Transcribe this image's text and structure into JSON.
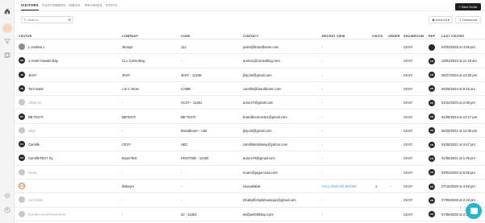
{
  "nav": {
    "tabs": [
      {
        "label": "VISITORS",
        "active": true
      },
      {
        "label": "CUSTOMERS",
        "active": false
      },
      {
        "label": "INBOX",
        "active": false
      },
      {
        "label": "REVIEWS",
        "active": false
      },
      {
        "label": "STATS",
        "active": false
      }
    ],
    "new_order_label": "New Order"
  },
  "toolbar": {
    "search_placeholder": "Search",
    "view_all_label": "View All",
    "download_label": "Download"
  },
  "table": {
    "headers": [
      "VISITOR",
      "COMPANY",
      "CODE",
      "CONTACT",
      "RECENT VIEW",
      "VISITS",
      "ORDER",
      "SHOWROOM",
      "REP",
      "LAST VISITED"
    ],
    "rows": [
      {
        "avatar": "",
        "avatar_style": "photo",
        "visitor": "L Andrew L",
        "company": "Jbongs",
        "code": "111",
        "contact": "justin@brandboom.com",
        "recent_view": "-",
        "visits": "",
        "order": "",
        "showroom": "CKSY",
        "rep": "",
        "last_visited": "04/03/2025 at 4:06 pm",
        "muted": false
      },
      {
        "avatar": "HH",
        "avatar_style": "dark",
        "visitor": "1 Hotel Hanalei Bay",
        "company": "CLJ Consulting",
        "code": "-",
        "contact": "aurie11@consulting.com",
        "recent_view": "-",
        "visits": "",
        "order": "",
        "showroom": "CKSY",
        "rep": "CR",
        "last_visited": "10/01/2024 at 11:19 am",
        "muted": false
      },
      {
        "avatar": "JK",
        "avatar_style": "dark",
        "visitor": "JKSY",
        "company": "JKSY",
        "code": "JKSY - 11248",
        "contact": "jksy.lol@gmail.com",
        "recent_view": "-",
        "visits": "",
        "order": "",
        "showroom": "CKSY",
        "rep": "CR",
        "last_visited": "06/27/2024 at 12:53 pm",
        "muted": false
      },
      {
        "avatar": "TS",
        "avatar_style": "dark",
        "visitor": "Toni Stark",
        "company": "J & C Store",
        "code": "CAMB",
        "contact": "camille@brandboom.com",
        "recent_view": "-",
        "visits": "",
        "order": "",
        "showroom": "CKSY",
        "rep": "CR",
        "last_visited": "06/26/2024 at 9:45 am",
        "muted": false
      },
      {
        "avatar": "",
        "avatar_style": "grey",
        "visitor": "Jillian Sy",
        "company": "-",
        "code": "ACSY - 11251",
        "contact": "aurum7@gmail.com",
        "recent_view": "-",
        "visits": "",
        "order": "",
        "showroom": "CKSY",
        "rep": "CR",
        "last_visited": "01/22/2024 at 2:08 pm",
        "muted": true
      },
      {
        "avatar": "BT",
        "avatar_style": "dark",
        "visitor": "BB TESTI",
        "company": "BBTESTI",
        "code": "BB TESTI",
        "contact": "brandboom.test1@gmail.com",
        "recent_view": "-",
        "visits": "",
        "order": "",
        "showroom": "CKSY",
        "rep": "CR",
        "last_visited": "01/08/2024 at 12:17 pm",
        "muted": false
      },
      {
        "avatar": "",
        "avatar_style": "grey",
        "visitor": "Jillyn",
        "company": "-",
        "code": "Brandboom - L56",
        "contact": "jksy.lol@gmail.com",
        "recent_view": "-",
        "visits": "",
        "order": "",
        "showroom": "CKSY",
        "rep": "CR",
        "last_visited": "06/29/2021 at 12:30 pm",
        "muted": true
      },
      {
        "avatar": "CA",
        "avatar_style": "dark",
        "visitor": "Camille",
        "company": "CKSY",
        "code": "ABC",
        "contact": "camillekristinesy@yahoo.com",
        "recent_view": "-",
        "visits": "",
        "order": "",
        "showroom": "CKSY",
        "rep": "CR",
        "last_visited": "04/26/2021 at 3:47 pm",
        "muted": false
      },
      {
        "avatar": "CS",
        "avatar_style": "dark",
        "visitor": "CamilleTEST Sy",
        "company": "BuyerTest",
        "code": "KRISTINE - 11260",
        "contact": "aurum79@gmail.com",
        "recent_view": "-",
        "visits": "",
        "order": "",
        "showroom": "CKSY",
        "rep": "CR",
        "last_visited": "01/05/2021 at 1:09 pm",
        "muted": false
      },
      {
        "avatar": "",
        "avatar_style": "grey",
        "visitor": "Noam",
        "company": "-",
        "code": "-",
        "contact": "noam@jayjun-usa.com",
        "recent_view": "-",
        "visits": "",
        "order": "",
        "showroom": "CKSY",
        "rep": "CR",
        "last_visited": "09/03/2020 at 5:09 pm",
        "muted": true
      },
      {
        "avatar": "GO",
        "avatar_style": "orange",
        "visitor": "",
        "company": "bbbuyer",
        "code": "-",
        "contact": "Unavailable",
        "recent_view": "FALL 2020 (02 SHOW)",
        "visits": "1",
        "order": "-",
        "showroom": "CKSY",
        "rep": "CR",
        "last_visited": "07/15/2020 at 4:59 pm",
        "muted": false
      },
      {
        "avatar": "",
        "avatar_style": "grey",
        "visitor": "Lief Stiles",
        "company": "-",
        "code": "-",
        "contact": "tzbabylifestyleboutique@gmail.com",
        "recent_view": "-",
        "visits": "",
        "order": "",
        "showroom": "CKSY",
        "rep": "CR",
        "last_visited": "07/09/2020 at 2:18 pm",
        "muted": true
      },
      {
        "avatar": "",
        "avatar_style": "grey",
        "visitor": "ELVIRA KUSRYASHOVA",
        "company": "-",
        "code": "10 - 11264",
        "contact": "ek@anthillshop.com",
        "recent_view": "-",
        "visits": "",
        "order": "",
        "showroom": "CKSY",
        "rep": "CR",
        "last_visited": "07/09/2020 at 2:37 pm",
        "muted": true
      }
    ]
  },
  "colors": {
    "accent": "#2bb5c8",
    "link": "#4a90c8",
    "dark": "#1e1e1e"
  }
}
